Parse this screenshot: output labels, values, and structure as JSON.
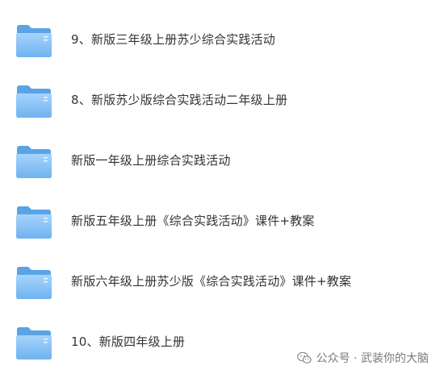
{
  "folders": [
    {
      "name": "9、新版三年级上册苏少综合实践活动",
      "icon": "folder-icon"
    },
    {
      "name": "8、新版苏少版综合实践活动二年级上册",
      "icon": "folder-icon"
    },
    {
      "name": "新版一年级上册综合实践活动",
      "icon": "folder-icon"
    },
    {
      "name": "新版五年级上册《综合实践活动》课件+教案",
      "icon": "folder-icon"
    },
    {
      "name": "新版六年级上册苏少版《综合实践活动》课件+教案",
      "icon": "folder-icon"
    },
    {
      "name": "10、新版四年级上册",
      "icon": "folder-icon"
    }
  ],
  "watermark": {
    "text": "公众号 · 武装你的大脑",
    "icon": "wechat-icon"
  },
  "colors": {
    "folder_back": "#5aa3e6",
    "folder_front_top": "#9fd0fb",
    "folder_front_bottom": "#72b5f2",
    "text": "#333333",
    "watermark": "#7a7a7a"
  }
}
